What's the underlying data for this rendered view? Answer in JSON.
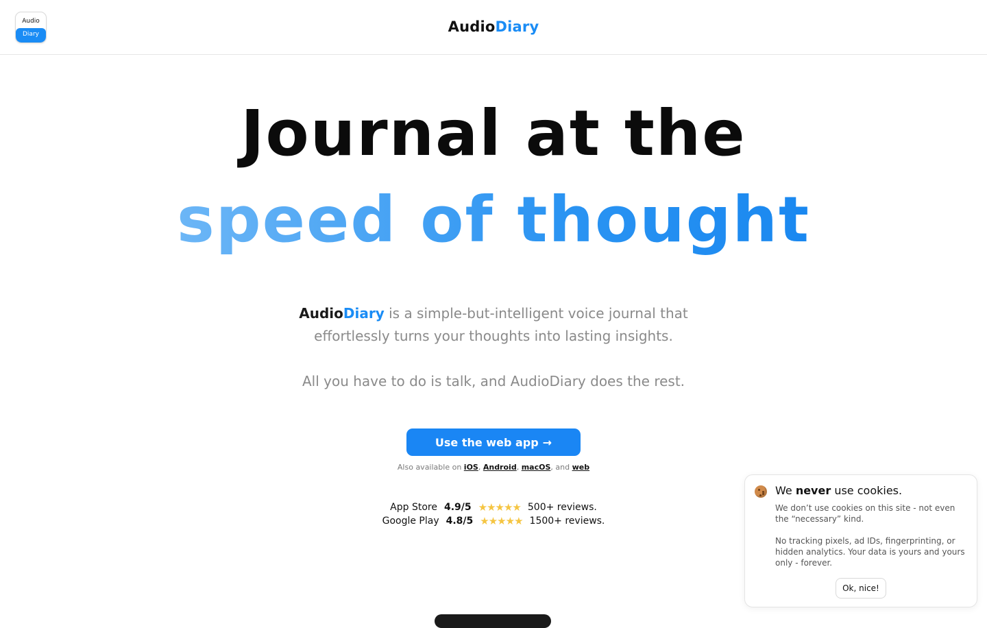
{
  "header": {
    "logo": {
      "top": "Audio",
      "bottom": "Diary"
    },
    "brand": {
      "part1": "Audio",
      "part2": "Diary"
    }
  },
  "hero": {
    "line1": "Journal at the",
    "line2": "speed of thought"
  },
  "description": {
    "brand_part1": "Audio",
    "brand_part2": "Diary",
    "text": " is a simple-but-intelligent voice journal that effortlessly turns your thoughts into lasting insights.",
    "line2": "All you have to do is talk, and AudioDiary does the rest."
  },
  "cta": {
    "label": "Use the web app",
    "arrow": "→"
  },
  "availability": {
    "prefix": "Also available on ",
    "links": [
      "iOS",
      "Android",
      "macOS",
      "web"
    ],
    "sep1": ", ",
    "sep2": ", ",
    "sep3": ", and "
  },
  "ratings": [
    {
      "store": "App Store",
      "score": "4.9/5",
      "stars": "★★★★★",
      "reviews": "500+ reviews."
    },
    {
      "store": "Google Play",
      "score": "4.8/5",
      "stars": "★★★★★",
      "reviews": "1500+ reviews."
    }
  ],
  "cookie": {
    "title_pre": "We ",
    "title_bold": "never",
    "title_post": " use cookies.",
    "p1": "We don’t use cookies on this site - not even the “necessary” kind.",
    "p2": "No tracking pixels, ad IDs, fingerprinting, or hidden analytics. Your data is yours and yours only - forever.",
    "button": "Ok, nice!"
  },
  "colors": {
    "accent": "#1a8cf5",
    "star": "#f5c542"
  }
}
